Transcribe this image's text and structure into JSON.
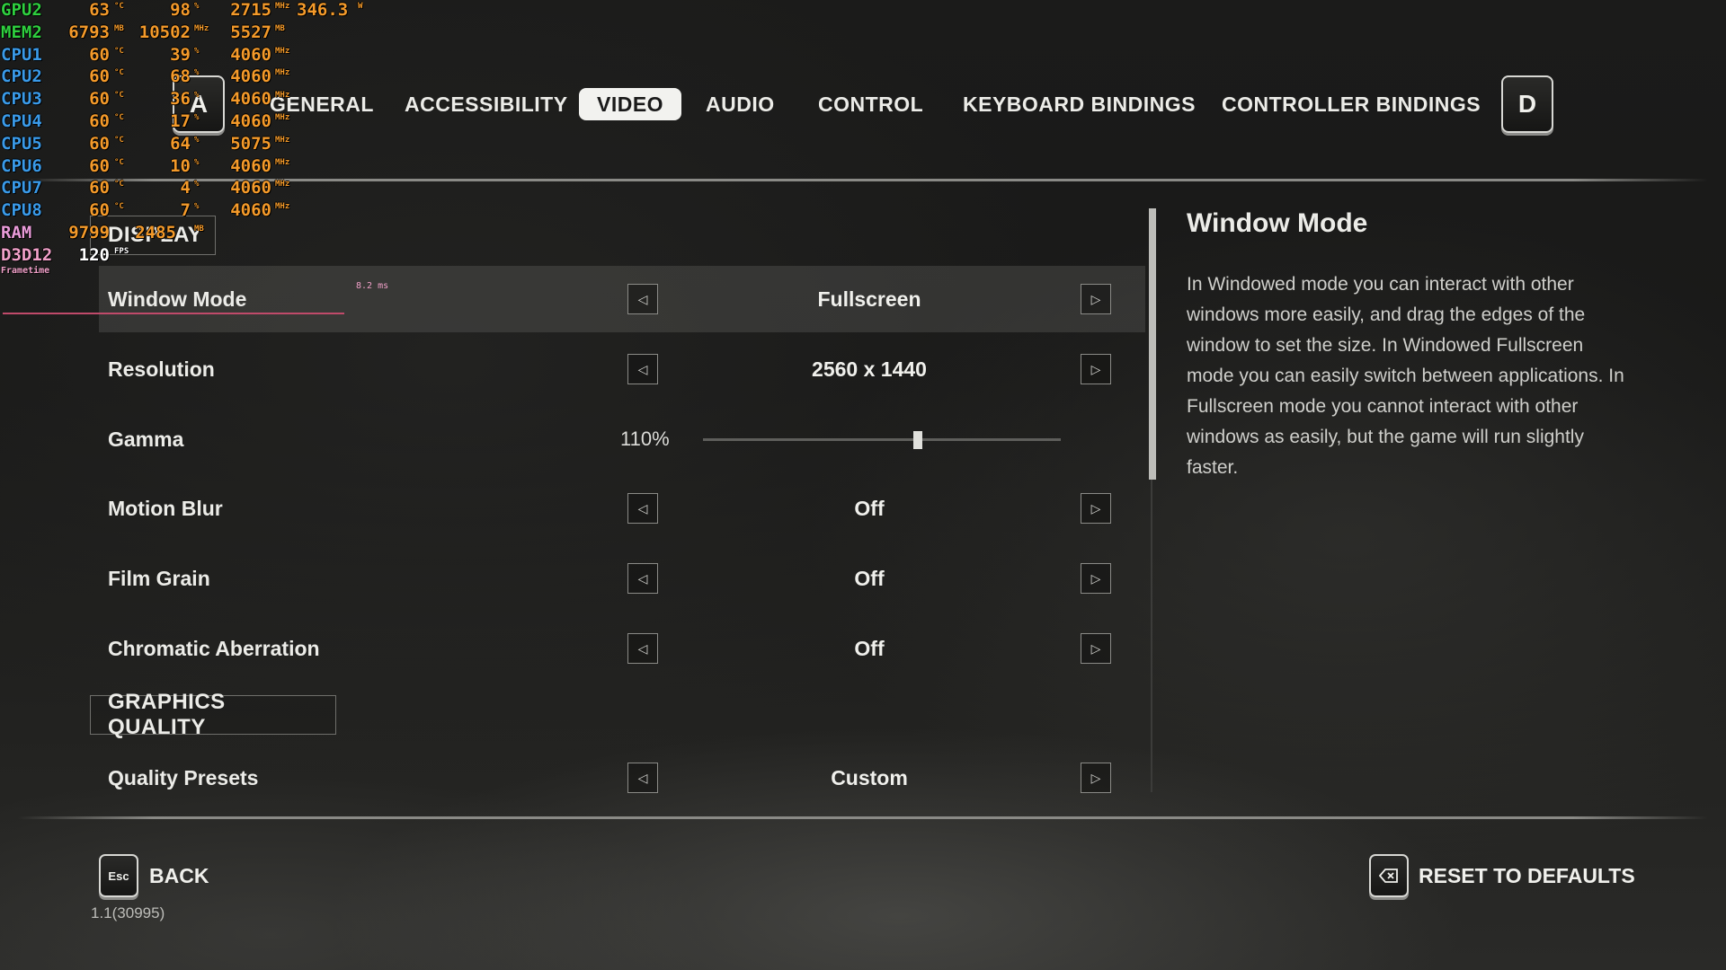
{
  "nav": {
    "prev_key": "A",
    "next_key": "D",
    "tabs": [
      {
        "label": "GENERAL"
      },
      {
        "label": "ACCESSIBILITY"
      },
      {
        "label": "VIDEO",
        "active": true
      },
      {
        "label": "AUDIO"
      },
      {
        "label": "CONTROL"
      },
      {
        "label": "KEYBOARD BINDINGS"
      },
      {
        "label": "CONTROLLER BINDINGS"
      }
    ]
  },
  "sections": {
    "display": "DISPLAY",
    "graphics_quality": "GRAPHICS QUALITY"
  },
  "settings": {
    "window_mode": {
      "label": "Window Mode",
      "value": "Fullscreen",
      "selected": true
    },
    "resolution": {
      "label": "Resolution",
      "value": "2560 x 1440"
    },
    "gamma": {
      "label": "Gamma",
      "value": "110%",
      "slider_fraction": 0.6
    },
    "motion_blur": {
      "label": "Motion Blur",
      "value": "Off"
    },
    "film_grain": {
      "label": "Film Grain",
      "value": "Off"
    },
    "chromatic_aberration": {
      "label": "Chromatic Aberration",
      "value": "Off"
    },
    "quality_presets": {
      "label": "Quality Presets",
      "value": "Custom"
    }
  },
  "info_panel": {
    "title": "Window Mode",
    "body": "In Windowed mode you can interact with other windows more easily, and drag the edges of the window to set the size. In Windowed Fullscreen mode you can easily switch between applications. In Fullscreen mode you cannot interact with other windows as easily, but the game will run slightly faster."
  },
  "footer": {
    "back_key": "Esc",
    "back_label": "BACK",
    "reset_label": "RESET TO DEFAULTS",
    "version": "1.1(30995)"
  },
  "overlay": {
    "gpu": {
      "label": "GPU2",
      "temp": "63",
      "temp_unit": "°C",
      "load": "98",
      "load_unit": "%",
      "clock": "2715",
      "clock_unit": "MHz",
      "power": "346.3",
      "power_unit": "W"
    },
    "mem": {
      "label": "MEM2",
      "used": "6793",
      "used_unit": "MB",
      "clock": "10502",
      "clock_unit": "MHz",
      "total": "5527",
      "total_unit": "MB"
    },
    "cpus": [
      {
        "label": "CPU1",
        "temp": "60",
        "load": "39",
        "clock": "4060"
      },
      {
        "label": "CPU2",
        "temp": "60",
        "load": "68",
        "clock": "4060"
      },
      {
        "label": "CPU3",
        "temp": "60",
        "load": "36",
        "clock": "4060"
      },
      {
        "label": "CPU4",
        "temp": "60",
        "load": "17",
        "clock": "4060"
      },
      {
        "label": "CPU5",
        "temp": "60",
        "load": "64",
        "clock": "5075"
      },
      {
        "label": "CPU6",
        "temp": "60",
        "load": "10",
        "clock": "4060"
      },
      {
        "label": "CPU7",
        "temp": "60",
        "load": "4",
        "clock": "4060"
      },
      {
        "label": "CPU8",
        "temp": "60",
        "load": "7",
        "clock": "4060"
      }
    ],
    "cpu_units": {
      "temp": "°C",
      "load": "%",
      "clock": "MHz"
    },
    "ram": {
      "label": "RAM",
      "used": "9799",
      "total": "2485",
      "unit": "MB"
    },
    "d3d": {
      "label": "D3D12",
      "fps": "120",
      "fps_unit": "FPS"
    },
    "frametime_label": "Frametime",
    "frametime_ms": "8.2 ms"
  },
  "colors": {
    "accent_tab_bg": "#f2f2ef",
    "osd_gpu": "#2fcf3f",
    "osd_cpu": "#3a9ae8",
    "osd_value": "#f49a2a"
  }
}
